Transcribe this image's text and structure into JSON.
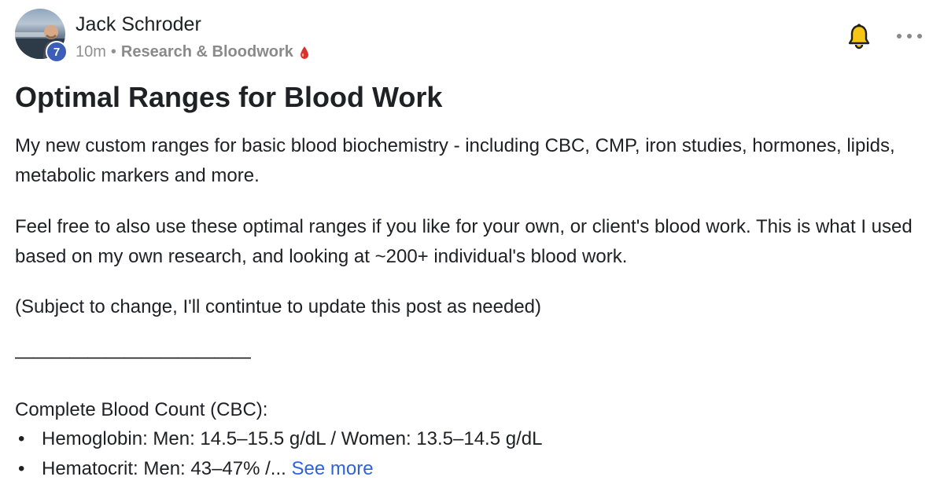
{
  "post": {
    "author": "Jack Schroder",
    "level": "7",
    "time": "10m",
    "separator": "•",
    "category": "Research & Bloodwork",
    "title": "Optimal Ranges for Blood Work",
    "paragraphs": [
      "My new custom ranges for basic blood biochemistry - including CBC, CMP, iron studies, hormones, lipids, metabolic markers and more.",
      "Feel free to also use these optimal ranges if you like for your own, or client's blood work. This is what I used based on my own research, and looking at ~200+ individual's blood work.",
      "(Subject to change, I'll contintue to update this post as needed)"
    ],
    "divider": "—————————————",
    "section_title": "Complete Blood Count (CBC):",
    "bullets": [
      "Hemoglobin: Men: 14.5–15.5 g/dL / Women: 13.5–14.5 g/dL",
      "Hematocrit: Men: 43–47% /..."
    ],
    "bullet_char": "•",
    "see_more": "See more"
  },
  "icons": {
    "notify": "bell-icon",
    "menu": "more-options-icon",
    "category_emoji": "blood-drop-icon"
  },
  "colors": {
    "link": "#2f63d6",
    "badge": "#3c5eb8",
    "bell_fill": "#f5c518",
    "drop": "#d9342b"
  }
}
